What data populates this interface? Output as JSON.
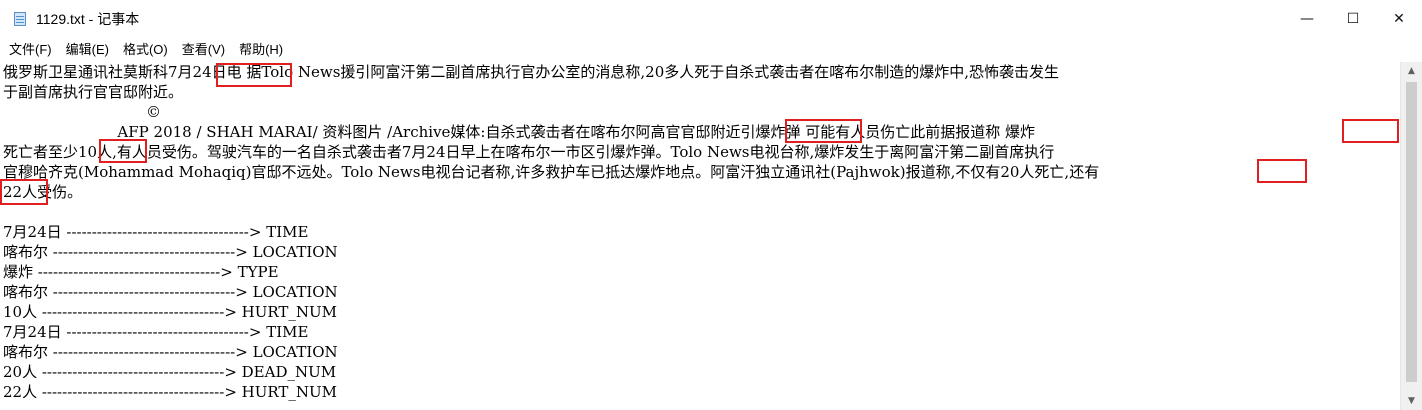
{
  "window": {
    "title": "1129.txt - 记事本",
    "icon": "notepad-icon",
    "controls": {
      "minimize": "—",
      "maximize": "☐",
      "close": "✕"
    }
  },
  "menu": [
    "文件(F)",
    "编辑(E)",
    "格式(O)",
    "查看(V)",
    "帮助(H)"
  ],
  "lines": [
    "俄罗斯卫星通讯社莫斯科7月24日电 据Tolo News援引阿富汗第二副首席执行官办公室的消息称,20多人死于自杀式袭击者在喀布尔制造的爆炸中,恐怖袭击发生",
    "于副首席执行官官邸附近。",
    "                              ©",
    "                        AFP 2018 / SHAH MARAI/ 资料图片 /Archive媒体:自杀式袭击者在喀布尔阿高官官邸附近引爆炸弹 可能有人员伤亡此前据报道称 爆炸",
    "死亡者至少10人,有人员受伤。驾驶汽车的一名自杀式袭击者7月24日早上在喀布尔一市区引爆炸弹。Tolo News电视台称,爆炸发生于离阿富汗第二副首席执行",
    "官穆哈齐克(Mohammad Mohaqiq)官邸不远处。Tolo News电视台记者称,许多救护车已抵达爆炸地点。阿富汗独立通讯社(Pajhwok)报道称,不仅有20人死亡,还有",
    "22人受伤。",
    "",
    "7月24日 ------------------------------------> TIME",
    "喀布尔 ------------------------------------> LOCATION",
    "爆炸 ------------------------------------> TYPE",
    "喀布尔 ------------------------------------> LOCATION",
    "10人 ------------------------------------> HURT_NUM",
    "7月24日 ------------------------------------> TIME",
    "喀布尔 ------------------------------------> LOCATION",
    "20人 ------------------------------------> DEAD_NUM",
    "22人 ------------------------------------> HURT_NUM"
  ],
  "highlight_color": "#e02020"
}
